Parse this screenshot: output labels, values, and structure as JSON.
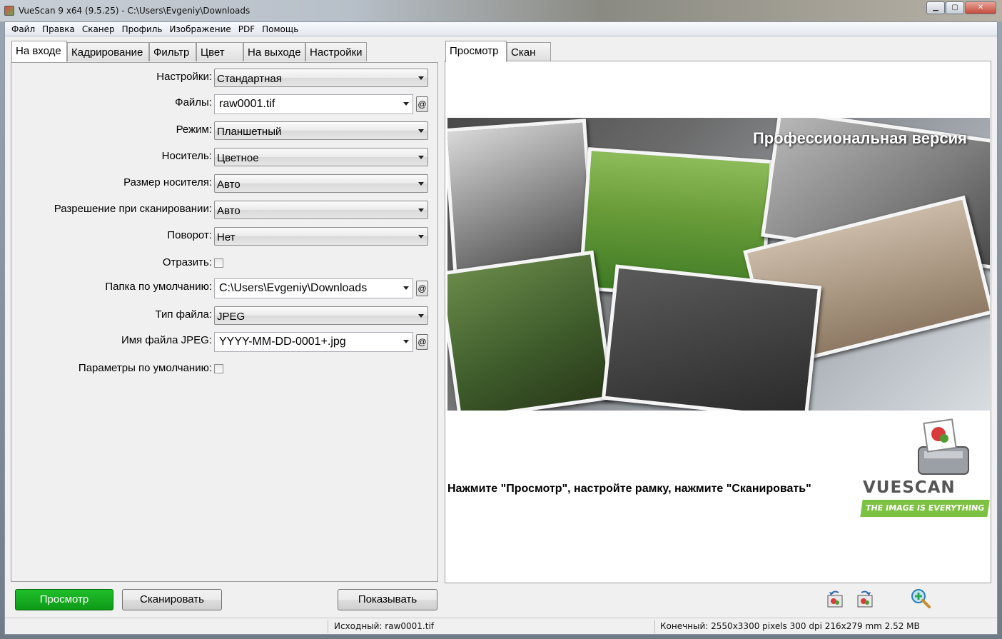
{
  "window": {
    "title": "VueScan 9 x64 (9.5.25) - C:\\Users\\Evgeniy\\Downloads",
    "controls": {
      "minimize": "▁",
      "maximize": "▢",
      "close": "✕"
    }
  },
  "menu": [
    "Файл",
    "Правка",
    "Сканер",
    "Профиль",
    "Изображение",
    "PDF",
    "Помощь"
  ],
  "left_tabs": [
    "На входе",
    "Кадрирование",
    "Фильтр",
    "Цвет",
    "На выходе",
    "Настройки"
  ],
  "right_tabs": [
    "Просмотр",
    "Скан"
  ],
  "form": {
    "settings": {
      "label": "Настройки:",
      "value": "Стандартная"
    },
    "files": {
      "label": "Файлы:",
      "value": "raw0001.tif",
      "button": "@"
    },
    "mode": {
      "label": "Режим:",
      "value": "Планшетный"
    },
    "media": {
      "label": "Носитель:",
      "value": "Цветное"
    },
    "media_size": {
      "label": "Размер носителя:",
      "value": "Авто"
    },
    "resolution": {
      "label": "Разрешение при сканировании:",
      "value": "Авто"
    },
    "rotation": {
      "label": "Поворот:",
      "value": "Нет"
    },
    "mirror": {
      "label": "Отразить:",
      "checked": false
    },
    "default_folder": {
      "label": "Папка по умолчанию:",
      "value": "C:\\Users\\Evgeniy\\Downloads",
      "button": "@"
    },
    "file_type": {
      "label": "Тип файла:",
      "value": "JPEG"
    },
    "jpeg_name": {
      "label": "Имя файла JPEG:",
      "value": "YYYY-MM-DD-0001+.jpg",
      "button": "@"
    },
    "defaults": {
      "label": "Параметры по умолчанию:",
      "checked": false
    }
  },
  "buttons": {
    "preview": "Просмотр",
    "scan": "Сканировать",
    "show": "Показывать"
  },
  "preview": {
    "pro_label": "Профессиональная версия",
    "instruction": "Нажмите \"Просмотр\", настройте рамку, нажмите \"Сканировать\"",
    "logo_text": "VUESCAN",
    "logo_tagline": "THE IMAGE IS EVERYTHING"
  },
  "toolbar_icons": [
    "rotate-left-icon",
    "rotate-right-icon",
    "zoom-in-icon"
  ],
  "status": {
    "source": "Исходный: raw0001.tif",
    "output": "Конечный: 2550x3300 pixels 300 dpi 216x279 mm 2.52 MB"
  },
  "colors": {
    "preview_button": "#12a81d",
    "logo_green": "#7dc142"
  }
}
